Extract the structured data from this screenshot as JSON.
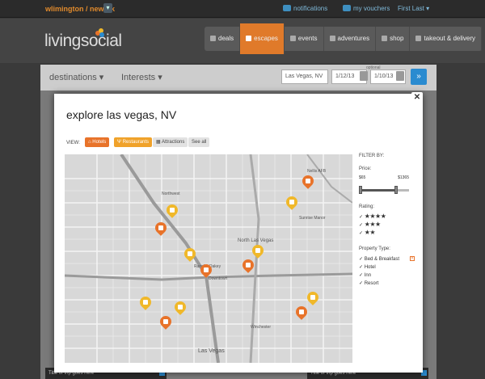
{
  "topbar": {
    "location": "wlimington / newark",
    "location_dropdown": "▾",
    "notifications": "notifications",
    "vouchers": "my vouchers",
    "user": "First Last ▾"
  },
  "header": {
    "logo": "livingsocial",
    "nav": [
      "deals",
      "escapes",
      "events",
      "adventures",
      "shop",
      "takeout & delivery"
    ],
    "active_nav": "escapes"
  },
  "filter": {
    "destinations": "destinations ▾",
    "interests": "Interests ▾",
    "location_value": "Las Vegas, NV",
    "optional_label": "optional",
    "date_from": "1/12/13",
    "date_to": "1/10/13",
    "go": "»"
  },
  "cards": [
    "Title of trip goes here",
    "Title of trip goes here"
  ],
  "modal": {
    "close": "✕",
    "title": "explore las vegas, NV",
    "view_label": "VIEW:",
    "view_buttons": [
      "Hotels",
      "Restaurants",
      "Attractions",
      "See all"
    ],
    "filter_title": "FILTER BY:",
    "price_label": "Price:",
    "price_min": "$65",
    "price_max": "$1365",
    "rating_label": "Rating:",
    "ratings": [
      "★★★★",
      "★★★",
      "★★"
    ],
    "property_label": "Property Type:",
    "property_types": [
      "Bed & Breakfast",
      "Hotel",
      "Inn",
      "Resort"
    ]
  },
  "map_labels": {
    "north_las_vegas": "North Las Vegas",
    "las_vegas": "Las Vegas",
    "downtown": "Downtown",
    "nellis_afb": "Nellis AFB",
    "sunrise_manor": "Sunrise Manor",
    "northwest": "Northwest",
    "rancho_oakey": "Rancho Oakey",
    "winchester": "Winchester"
  },
  "colors": {
    "accent_orange": "#e8732a",
    "restaurant_yellow": "#f0b82a",
    "go_blue": "#2a8bd0"
  }
}
